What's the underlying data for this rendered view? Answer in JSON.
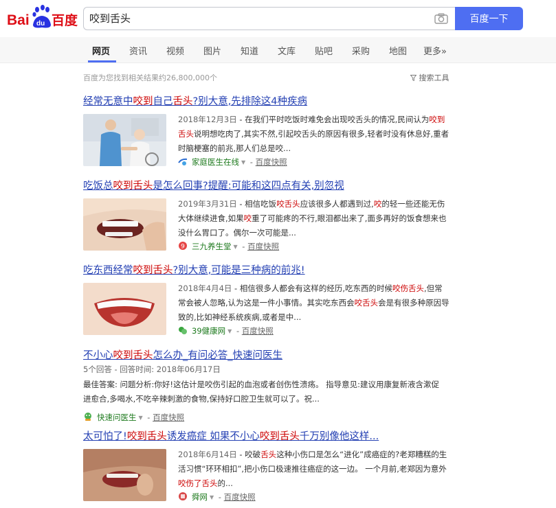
{
  "header": {
    "logo_text_left": "Bai",
    "logo_text_du": "du",
    "logo_text_right": "百度",
    "search_value": "咬到舌头",
    "search_button": "百度一下"
  },
  "tabs": [
    {
      "label": "网页",
      "active": true
    },
    {
      "label": "资讯"
    },
    {
      "label": "视频"
    },
    {
      "label": "图片"
    },
    {
      "label": "知道"
    },
    {
      "label": "文库"
    },
    {
      "label": "贴吧"
    },
    {
      "label": "采购"
    },
    {
      "label": "地图"
    },
    {
      "label": "更多»"
    }
  ],
  "meta": {
    "result_count": "百度为您找到相关结果约26,800,000个",
    "search_tools": "搜索工具"
  },
  "results": [
    {
      "title_parts": [
        "经常无意中",
        "咬到",
        "自己",
        "舌头",
        "?别大意,先排除这4种疾病"
      ],
      "date": "2018年12月3日",
      "snippet_parts": [
        " - 在我们平时吃饭时难免会出现咬舌头的情况,民间认为",
        "咬到舌头",
        "说明想吃肉了,其实不然,引起咬舌头的原因有很多,轻者时没有休息好,重者时脑梗塞的前兆,那人们总是咬..."
      ],
      "source": "家庭医生在线",
      "snapshot": "百度快照"
    },
    {
      "title_parts": [
        "吃饭总",
        "咬到舌头",
        "是怎么回事?提醒:可能和这四点有关,别忽视"
      ],
      "date": "2019年3月31日",
      "snippet_parts": [
        " - 相信吃饭",
        "咬舌头",
        "应该很多人都遇到过,",
        "咬",
        "的轻一些还能无伤大体继续进食,如果",
        "咬",
        "重了可能疼的不行,眼泪都出来了,面多再好的饭食想来也没什么胃口了。偶尔一次可能是..."
      ],
      "source": "三九养生堂",
      "snapshot": "百度快照"
    },
    {
      "title_parts": [
        "吃东西经常",
        "咬到舌头",
        "?别大意,可能是三种病的前兆!"
      ],
      "date": "2018年4月4日",
      "snippet_parts": [
        " - 相信很多人都会有这样的经历,吃东西的时候",
        "咬伤舌头",
        ",但常常会被人忽略,认为这是一件小事情。其实吃东西会",
        "咬舌头",
        "会是有很多种原因导致的,比如神经系统疾病,或者是中..."
      ],
      "source": "39健康网",
      "snapshot": "百度快照"
    },
    {
      "title_parts": [
        "不小心",
        "咬到舌头",
        "怎么办_有问必答_快速问医生"
      ],
      "qa_meta": "5个回答 - 回答时间: 2018年06月17日",
      "snippet": "最佳答案: 问题分析:你好!这估计是咬伤引起的血泡或者创伤性溃疡。 指导意见:建议用康复新液含漱促进愈合,多喝水,不吃辛辣刺激的食物,保持好口腔卫生就可以了。祝...",
      "source": "快速问医生",
      "snapshot": "百度快照"
    },
    {
      "title_parts": [
        "太可怕了!",
        "咬到舌头",
        "诱发癌症 如果不小心",
        "咬到舌头",
        "千万别像他这样..."
      ],
      "date": "2018年6月14日",
      "snippet_parts": [
        " - 咬破",
        "舌头",
        "这种小伤口是怎么“进化”成癌症的?老郑糟糕的生活习惯“环环相扣”,把小伤口极速推往癌症的这一边。 一个月前,老郑因为意外",
        "咬伤了舌头",
        "的..."
      ],
      "source": "舜网",
      "snapshot": "百度快照"
    }
  ],
  "colors": {
    "brand_blue": "#4e6ef2",
    "link_blue": "#2440b3",
    "highlight_red": "#c00",
    "source_green": "#1e7a1e"
  }
}
